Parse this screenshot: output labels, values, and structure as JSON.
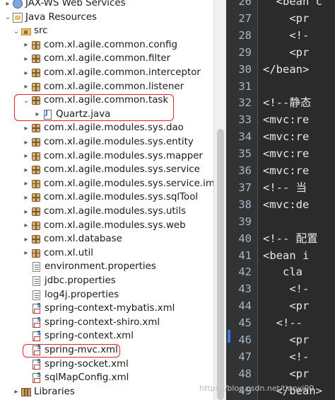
{
  "explorer": {
    "items": [
      {
        "label": "JAX-WS Web Services",
        "icon": "jaxws",
        "twisty": "▸",
        "indent": 4
      },
      {
        "label": "Java Resources",
        "icon": "javares",
        "twisty": "⌄",
        "indent": 4
      },
      {
        "label": "src",
        "icon": "srcfolder",
        "twisty": "⌄",
        "indent": 16
      },
      {
        "label": "com.xl.agile.common.config",
        "icon": "pkg",
        "twisty": "▸",
        "indent": 30
      },
      {
        "label": "com.xl.agile.common.filter",
        "icon": "pkg",
        "twisty": "▸",
        "indent": 30
      },
      {
        "label": "com.xl.agile.common.interceptor",
        "icon": "pkg",
        "twisty": "▸",
        "indent": 30
      },
      {
        "label": "com.xl.agile.common.listener",
        "icon": "pkg",
        "twisty": "▸",
        "indent": 30
      },
      {
        "label": "com.xl.agile.common.task",
        "icon": "pkg",
        "twisty": "⌄",
        "indent": 30
      },
      {
        "label": "Quartz.java",
        "icon": "java",
        "twisty": "▸",
        "indent": 46
      },
      {
        "label": "com.xl.agile.modules.sys.dao",
        "icon": "pkg",
        "twisty": "▸",
        "indent": 30
      },
      {
        "label": "com.xl.agile.modules.sys.entity",
        "icon": "pkg",
        "twisty": "▸",
        "indent": 30
      },
      {
        "label": "com.xl.agile.modules.sys.mapper",
        "icon": "pkg",
        "twisty": "▸",
        "indent": 30
      },
      {
        "label": "com.xl.agile.modules.sys.service",
        "icon": "pkg",
        "twisty": "▸",
        "indent": 30
      },
      {
        "label": "com.xl.agile.modules.sys.service.impl",
        "icon": "pkg",
        "twisty": "▸",
        "indent": 30
      },
      {
        "label": "com.xl.agile.modules.sys.sqlTool",
        "icon": "pkg",
        "twisty": "▸",
        "indent": 30
      },
      {
        "label": "com.xl.agile.modules.sys.utils",
        "icon": "pkg",
        "twisty": "▸",
        "indent": 30
      },
      {
        "label": "com.xl.agile.modules.sys.web",
        "icon": "pkg",
        "twisty": "▸",
        "indent": 30
      },
      {
        "label": "com.xl.database",
        "icon": "pkg",
        "twisty": "▸",
        "indent": 30
      },
      {
        "label": "com.xl.util",
        "icon": "pkg",
        "twisty": "▸",
        "indent": 30
      },
      {
        "label": "environment.properties",
        "icon": "props",
        "twisty": "",
        "indent": 30
      },
      {
        "label": "jdbc.properties",
        "icon": "props",
        "twisty": "",
        "indent": 30
      },
      {
        "label": "log4j.properties",
        "icon": "props",
        "twisty": "",
        "indent": 30
      },
      {
        "label": "spring-context-mybatis.xml",
        "icon": "xml",
        "twisty": "",
        "indent": 30
      },
      {
        "label": "spring-context-shiro.xml",
        "icon": "xml",
        "twisty": "",
        "indent": 30
      },
      {
        "label": "spring-context.xml",
        "icon": "xml",
        "twisty": "",
        "indent": 30
      },
      {
        "label": "spring-mvc.xml",
        "icon": "xml",
        "twisty": "",
        "indent": 30
      },
      {
        "label": "spring-socket.xml",
        "icon": "xml",
        "twisty": "",
        "indent": 30
      },
      {
        "label": "sqlMapConfig.xml",
        "icon": "xml",
        "twisty": "",
        "indent": 30
      },
      {
        "label": "Libraries",
        "icon": "lib",
        "twisty": "▸",
        "indent": 16
      }
    ]
  },
  "editor": {
    "lines": [
      {
        "no": "26",
        "text": "  <bean c"
      },
      {
        "no": "27",
        "text": "    <pr"
      },
      {
        "no": "28",
        "text": "    <!-"
      },
      {
        "no": "29",
        "text": "    <pr"
      },
      {
        "no": "30",
        "text": "</bean>"
      },
      {
        "no": "31",
        "text": ""
      },
      {
        "no": "32",
        "text": "<!--静态"
      },
      {
        "no": "33",
        "text": "<mvc:re"
      },
      {
        "no": "34",
        "text": "<mvc:re"
      },
      {
        "no": "35",
        "text": "<mvc:re"
      },
      {
        "no": "36",
        "text": "<mvc:re"
      },
      {
        "no": "37",
        "text": "<!-- 当"
      },
      {
        "no": "38",
        "text": "<mvc:de"
      },
      {
        "no": "39",
        "text": ""
      },
      {
        "no": "40",
        "text": "<!-- 配置"
      },
      {
        "no": "41",
        "text": "<bean i"
      },
      {
        "no": "42",
        "text": "   cla"
      },
      {
        "no": "43",
        "text": "    <!-"
      },
      {
        "no": "44",
        "text": "    <pr"
      },
      {
        "no": "45",
        "text": "  <!--"
      },
      {
        "no": "46",
        "text": "    <pr"
      },
      {
        "no": "47",
        "text": "    <!-"
      },
      {
        "no": "48",
        "text": "    <pr"
      },
      {
        "no": "49",
        "text": "  </bean>"
      }
    ]
  },
  "watermark": "https://blog.csdn.net/tianyi00"
}
